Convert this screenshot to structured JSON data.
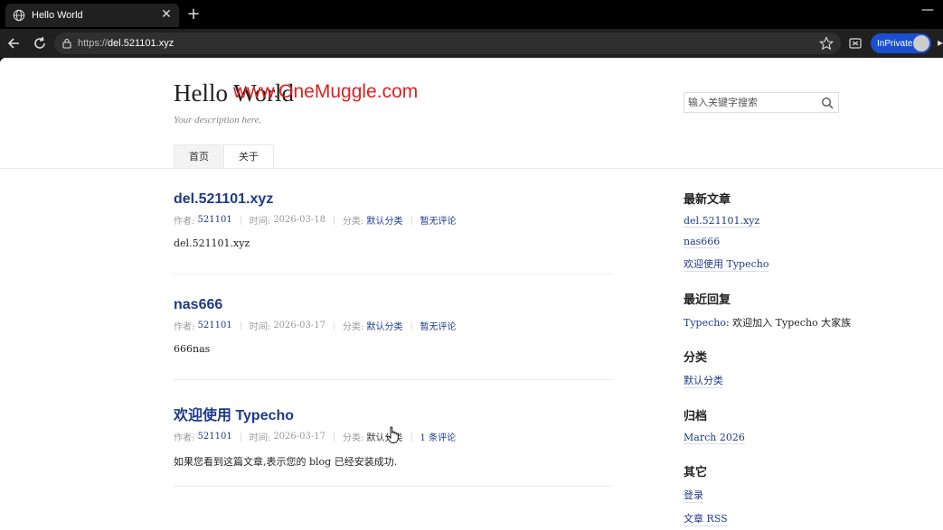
{
  "browser": {
    "tab_title": "Hello World",
    "tab_close": "✕",
    "new_tab": "+",
    "url_scheme": "https://",
    "url_host": "del.521101.xyz",
    "inprivate_label": "InPrivate"
  },
  "site": {
    "title": "Hello World",
    "watermark": "www.OneMuggle.com",
    "description": "Your description here."
  },
  "search": {
    "placeholder": "输入关键字搜索"
  },
  "nav": {
    "items": [
      "首页",
      "关于"
    ]
  },
  "posts": [
    {
      "title": "del.521101.xyz",
      "author_label": "作者:",
      "author": "521101",
      "time_label": "时间:",
      "time": "2026-03-18",
      "category_label": "分类:",
      "category": "默认分类",
      "comments": "暂无评论",
      "excerpt": "del.521101.xyz"
    },
    {
      "title": "nas666",
      "author_label": "作者:",
      "author": "521101",
      "time_label": "时间:",
      "time": "2026-03-17",
      "category_label": "分类:",
      "category": "默认分类",
      "comments": "暂无评论",
      "excerpt": "666nas"
    },
    {
      "title": "欢迎使用 Typecho",
      "author_label": "作者:",
      "author": "521101",
      "time_label": "时间:",
      "time": "2026-03-17",
      "category_label": "分类:",
      "category": "默认分类",
      "comments": "1 条评论",
      "excerpt": "如果您看到这篇文章,表示您的 blog 已经安装成功."
    }
  ],
  "sidebar": {
    "recent_posts_title": "最新文章",
    "recent_posts": [
      "del.521101.xyz",
      "nas666",
      "欢迎使用 Typecho"
    ],
    "recent_comments_title": "最近回复",
    "recent_comment_author": "Typecho",
    "recent_comment_text": ": 欢迎加入 Typecho 大家族",
    "categories_title": "分类",
    "categories": [
      "默认分类"
    ],
    "archives_title": "归档",
    "archives": [
      "March 2026"
    ],
    "other_title": "其它",
    "other_links": [
      "登录",
      "文章 RSS"
    ]
  }
}
